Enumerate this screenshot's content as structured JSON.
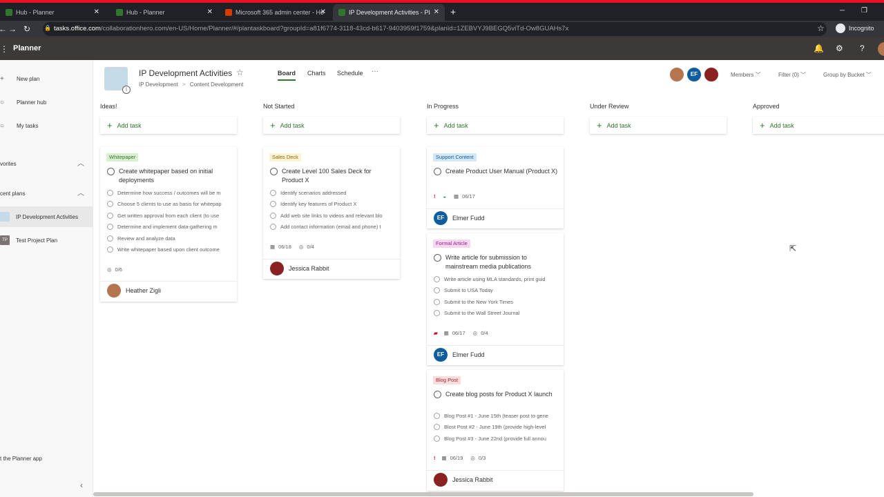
{
  "browser": {
    "tabs": [
      {
        "title": "Hub - Planner",
        "icon": "planner-icon"
      },
      {
        "title": "Hub - Planner",
        "icon": "planner-icon"
      },
      {
        "title": "Microsoft 365 admin center - Ho",
        "icon": "office-icon"
      },
      {
        "title": "IP Development Activities - Plan",
        "icon": "planner-icon",
        "active": true
      }
    ],
    "url_domain": "tasks.office.com",
    "url_path": "/collaborationhero.com/en-US/Home/Planner/#/plantaskboard?groupId=a81f6774-3118-43cd-b617-9403959f1759&planId=1ZEBVYJ9BEGQ5viTd-Ow8GUAHs7x",
    "profile": "Incognito"
  },
  "suite": {
    "app_name": "Planner"
  },
  "sidebar": {
    "items": [
      {
        "label": "New plan",
        "icon": "plus-icon"
      },
      {
        "label": "Planner hub",
        "icon": "hub-icon"
      },
      {
        "label": "My tasks",
        "icon": "check-circle-icon"
      }
    ],
    "favorites_label": "vorites",
    "recent_label": "cent plans",
    "recent": [
      {
        "label": "IP Development Activities",
        "selected": true
      },
      {
        "label": "Test Project Plan",
        "initials": "TP"
      }
    ],
    "get_app": "t the Planner app"
  },
  "plan": {
    "title": "IP Development Activities",
    "breadcrumb_group": "IP Development",
    "breadcrumb_sep": ">",
    "breadcrumb_sub": "Content Development",
    "tabs": [
      "Board",
      "Charts",
      "Schedule"
    ],
    "more": "···",
    "members_label": "Members",
    "filter_label": "Filter (0)",
    "group_label": "Group by Bucket",
    "member_initials": "EF"
  },
  "colors": {
    "accent": "#31752f",
    "urgent": "#c50f1f",
    "avatar_ef": "#0f5d9e"
  },
  "buckets": [
    {
      "name": "Ideas!",
      "add_task": "Add task",
      "cards": [
        {
          "label": "Whitepaper",
          "title": "Create whitepaper based on initial deployments",
          "checklist": [
            "Determine how success / outcomes will be m",
            "Choose 5 clients to use as basis for whitepap",
            "Get written approval from each client (to use",
            "Determine and implement data-gathering m",
            "Review and analyze data",
            "Write whitepaper based upon client outcome"
          ],
          "progress": "0/6",
          "assignee": "Heather Zigli"
        }
      ]
    },
    {
      "name": "Not Started",
      "add_task": "Add task",
      "cards": [
        {
          "label": "Sales Deck",
          "title": "Create Level 100 Sales Deck for Product X",
          "checklist": [
            "Identify scenarios addressed",
            "Identify key features of Product X",
            "Add web site links to videos and relevant blo",
            "Add contact information (email and phone) t"
          ],
          "due": "06/18",
          "progress": "0/4",
          "assignee": "Jessica Rabbit"
        }
      ]
    },
    {
      "name": "In Progress",
      "add_task": "Add task",
      "cards": [
        {
          "label": "Support Content",
          "title": "Create Product User Manual (Product X)",
          "priority": "!",
          "due": "06/17",
          "assignee": "Elmer Fudd",
          "initials": "EF"
        },
        {
          "label": "Formal Article",
          "title": "Write article for submission to mainstream media publications",
          "checklist": [
            "Write article using MLA standards, print guid",
            "Submit to USA Today",
            "Submit to the New York Times",
            "Submit to the Wall Street Journal"
          ],
          "due": "06/17",
          "progress": "0/4",
          "assignee": "Elmer Fudd",
          "initials": "EF"
        },
        {
          "label": "Blog Post",
          "title": "Create blog posts for Product X launch",
          "checklist": [
            "Blog Post #1 - June 15th (teaser post to gene",
            "Blost Post #2 - June 19th (provide high-level",
            "Blog Post #3 - June 22nd (provide full annou"
          ],
          "priority": "!",
          "due": "06/19",
          "progress": "0/3",
          "assignee": "Jessica Rabbit"
        }
      ]
    },
    {
      "name": "Under Review",
      "add_task": "Add task",
      "cards": []
    },
    {
      "name": "Approved",
      "add_task": "Add task",
      "cards": []
    }
  ]
}
